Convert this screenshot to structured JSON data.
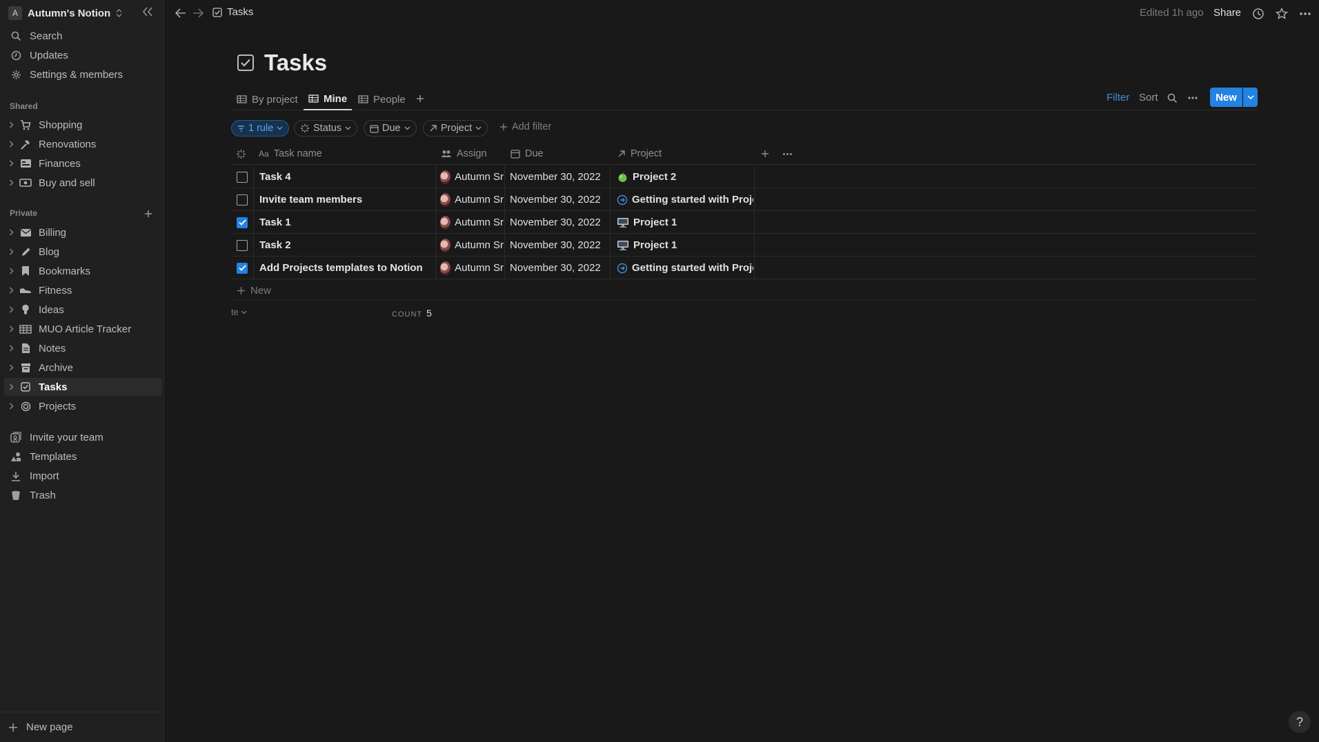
{
  "workspace": {
    "initial": "A",
    "name": "Autumn's Notion"
  },
  "sidebar": {
    "top_items": [
      {
        "label": "Search",
        "icon": "search-icon"
      },
      {
        "label": "Updates",
        "icon": "clock-icon"
      },
      {
        "label": "Settings & members",
        "icon": "gear-icon"
      }
    ],
    "shared_label": "Shared",
    "shared": [
      {
        "label": "Shopping",
        "icon": "cart-icon"
      },
      {
        "label": "Renovations",
        "icon": "hammer-icon"
      },
      {
        "label": "Finances",
        "icon": "ledger-icon"
      },
      {
        "label": "Buy and sell",
        "icon": "money-icon"
      }
    ],
    "private_label": "Private",
    "private": [
      {
        "label": "Billing",
        "icon": "mail-icon"
      },
      {
        "label": "Blog",
        "icon": "pencil-icon"
      },
      {
        "label": "Bookmarks",
        "icon": "bookmark-icon"
      },
      {
        "label": "Fitness",
        "icon": "shoe-icon"
      },
      {
        "label": "Ideas",
        "icon": "bulb-icon"
      },
      {
        "label": "MUO Article Tracker",
        "icon": "table-icon"
      },
      {
        "label": "Notes",
        "icon": "note-icon"
      },
      {
        "label": "Archive",
        "icon": "archive-icon"
      },
      {
        "label": "Tasks",
        "icon": "checkbox-icon"
      },
      {
        "label": "Projects",
        "icon": "target-icon"
      }
    ],
    "bottom_items": [
      {
        "label": "Invite your team",
        "icon": "invite-icon"
      },
      {
        "label": "Templates",
        "icon": "templates-icon"
      },
      {
        "label": "Import",
        "icon": "import-icon"
      },
      {
        "label": "Trash",
        "icon": "trash-icon"
      }
    ],
    "new_page": "New page"
  },
  "topbar": {
    "breadcrumb": "Tasks",
    "edited": "Edited 1h ago",
    "share": "Share"
  },
  "page": {
    "title": "Tasks"
  },
  "views": {
    "tabs": [
      {
        "label": "By project"
      },
      {
        "label": "Mine"
      },
      {
        "label": "People"
      }
    ],
    "filter": "Filter",
    "sort": "Sort",
    "new": "New"
  },
  "filters": {
    "rule": "1 rule",
    "chips": [
      "Status",
      "Due",
      "Project"
    ],
    "add": "Add filter"
  },
  "table": {
    "columns": {
      "name": "Task name",
      "assign": "Assign",
      "due": "Due",
      "project": "Project"
    },
    "rows": [
      {
        "done": false,
        "name": "Task 4",
        "assign": "Autumn Sr",
        "due": "November 30, 2022",
        "project": "Project 2",
        "project_icon": "apple-icon"
      },
      {
        "done": false,
        "name": "Invite team members",
        "assign": "Autumn Sr",
        "due": "November 30, 2022",
        "project": "Getting started with Projec",
        "project_icon": "arrow-circle-icon"
      },
      {
        "done": true,
        "name": "Task 1",
        "assign": "Autumn Sr",
        "due": "November 30, 2022",
        "project": "Project 1",
        "project_icon": "computer-icon"
      },
      {
        "done": false,
        "name": "Task 2",
        "assign": "Autumn Sr",
        "due": "November 30, 2022",
        "project": "Project 1",
        "project_icon": "computer-icon"
      },
      {
        "done": true,
        "name": "Add Projects templates to Notion",
        "assign": "Autumn Sr",
        "due": "November 30, 2022",
        "project": "Getting started with Projec",
        "project_icon": "arrow-circle-icon"
      }
    ],
    "new_row": "New",
    "calc_label": "te",
    "count_label": "COUNT",
    "count_value": "5"
  },
  "help": "?"
}
